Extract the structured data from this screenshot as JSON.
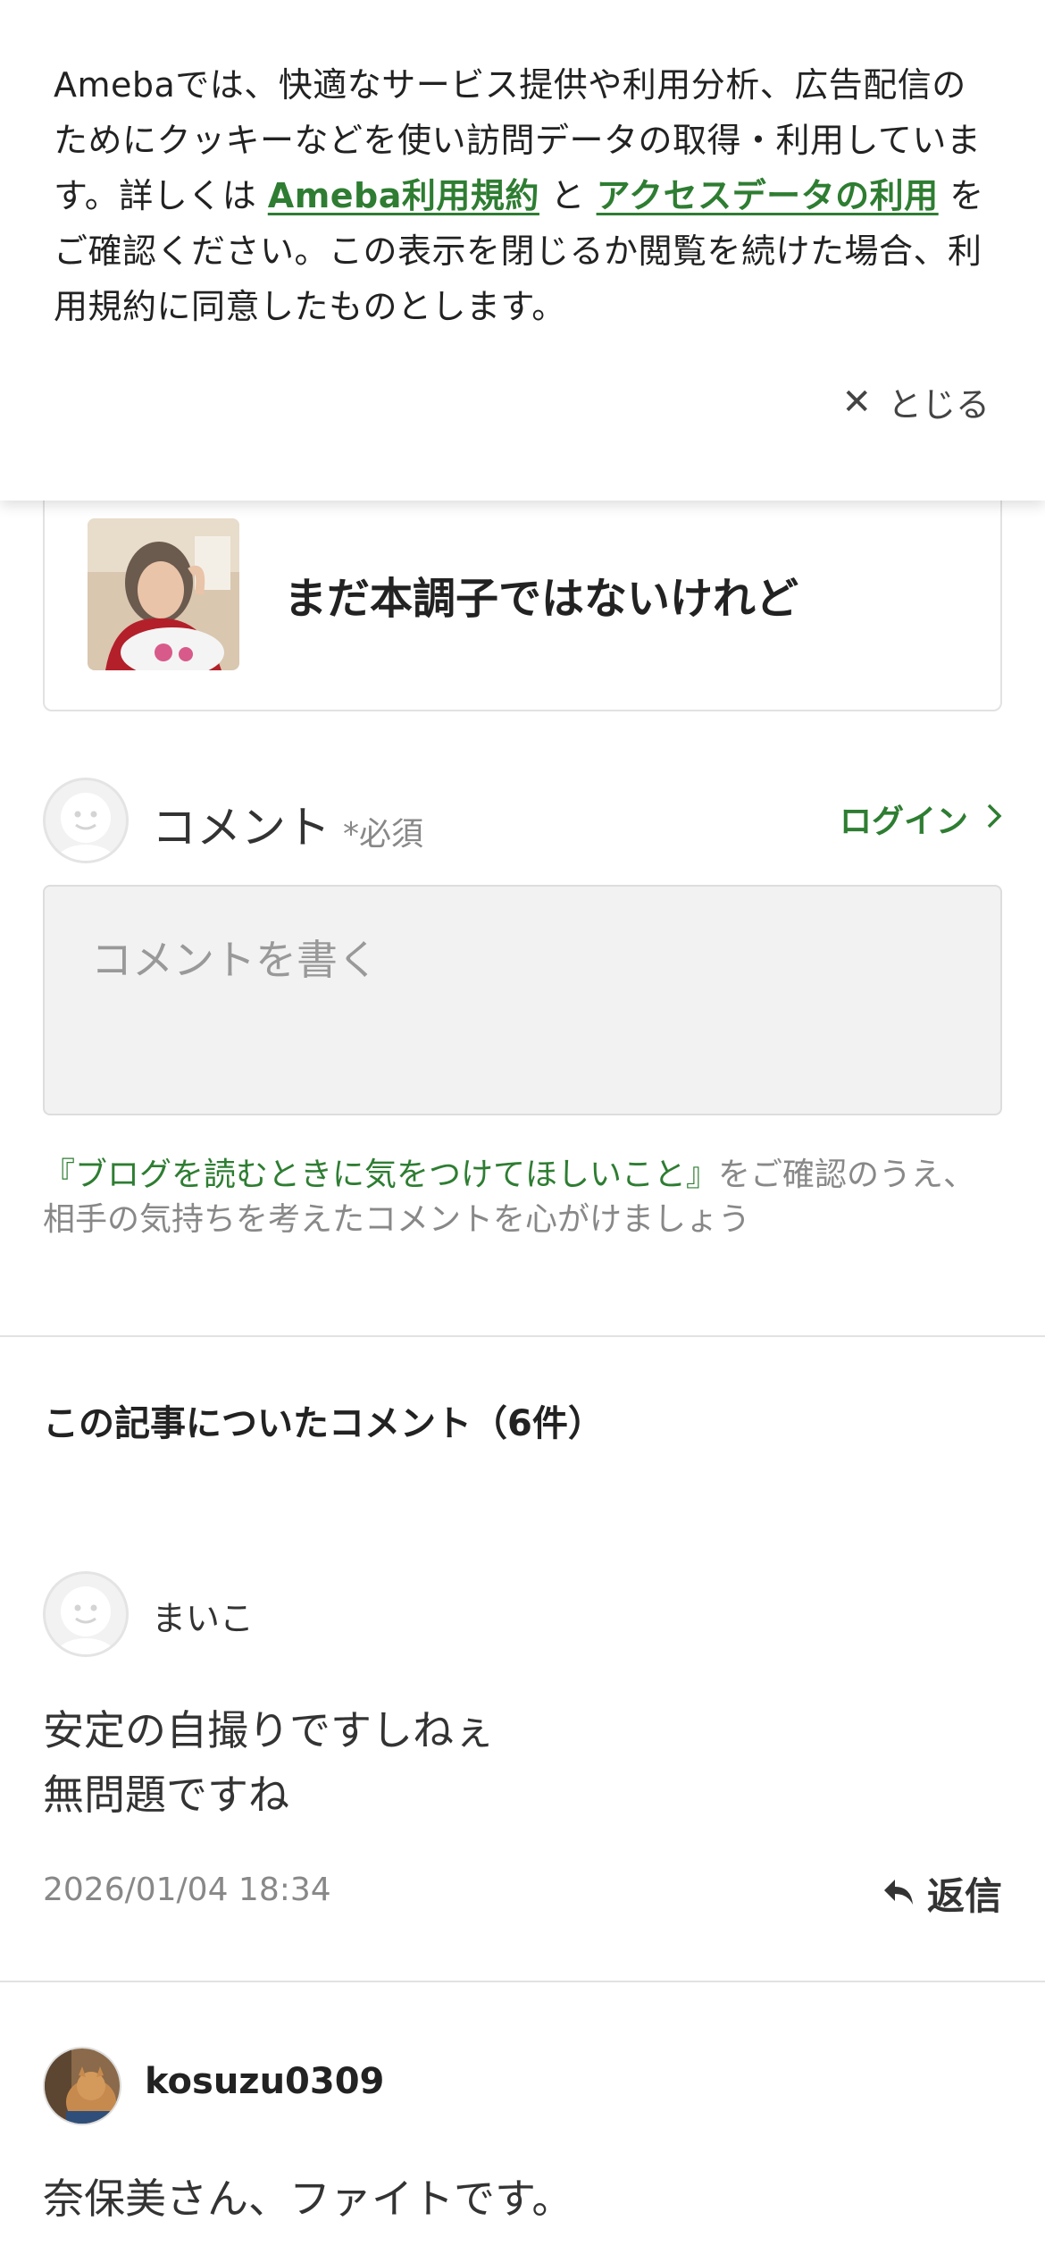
{
  "cookie_banner": {
    "text_before_link1": "Amebaでは、快適なサービス提供や利用分析、広告配信のためにクッキーなどを使い訪問データの取得・利用しています。詳しくは ",
    "link1_label": "Ameba利用規約",
    "text_between": " と ",
    "link2_label": "アクセスデータの利用",
    "text_after": " をご確認ください。この表示を閉じるか閲覧を続けた場合、利用規約に同意したものとします。",
    "close_label": "とじる"
  },
  "blog_card": {
    "title": "まだ本調子ではないけれど"
  },
  "comment_form": {
    "label": "コメント",
    "required_mark": "*必須",
    "login_label": "ログイン",
    "textarea_placeholder": "コメントを書く",
    "guideline_link": "『ブログを読むときに気をつけてほしいこと』",
    "guideline_text": "をご確認のうえ、相手の気持ちを考えたコメントを心がけましょう"
  },
  "comments_section": {
    "title": "この記事についたコメント（6件）",
    "reply_label": "返信",
    "items": [
      {
        "author": "まいこ",
        "body_line1": "安定の自撮りですしねぇ",
        "body_line2": "無問題ですね",
        "date": "2026/01/04 18:34"
      },
      {
        "author": "kosuzu0309",
        "body_line1": "奈保美さん、ファイトです。"
      }
    ]
  },
  "colors": {
    "accent_green": "#2e7d32",
    "muted_text": "#888888",
    "textarea_bg": "#f2f2f2"
  }
}
